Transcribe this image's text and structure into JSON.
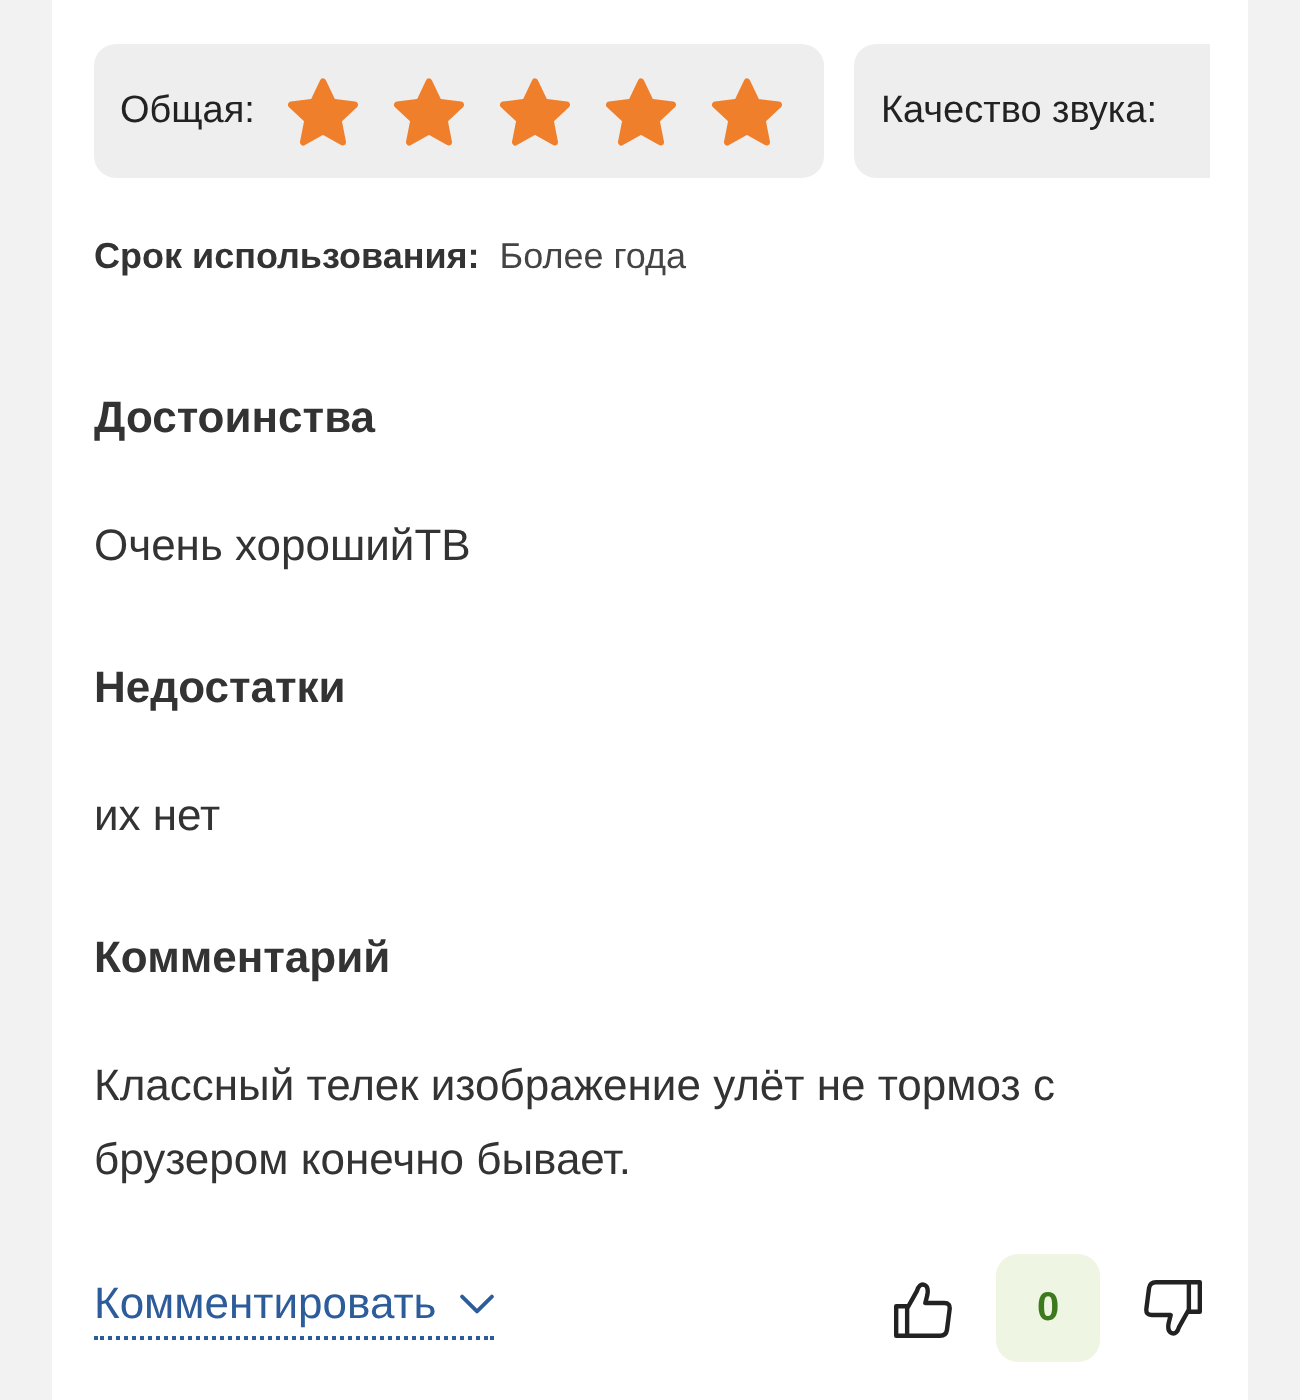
{
  "ratings": [
    {
      "label": "Общая:",
      "stars": 5
    },
    {
      "label": "Качество звука:"
    }
  ],
  "usage": {
    "label": "Срок использования:",
    "value": "Более года"
  },
  "sections": [
    {
      "title": "Достоинства",
      "text": "Очень хорошийТВ"
    },
    {
      "title": "Недостатки",
      "text": "их нет"
    },
    {
      "title": "Комментарий",
      "text": "Классный телек изображение улёт не тормоз с брузером конечно бывает."
    }
  ],
  "footer": {
    "comment_link": "Комментировать",
    "vote_count": "0"
  }
}
